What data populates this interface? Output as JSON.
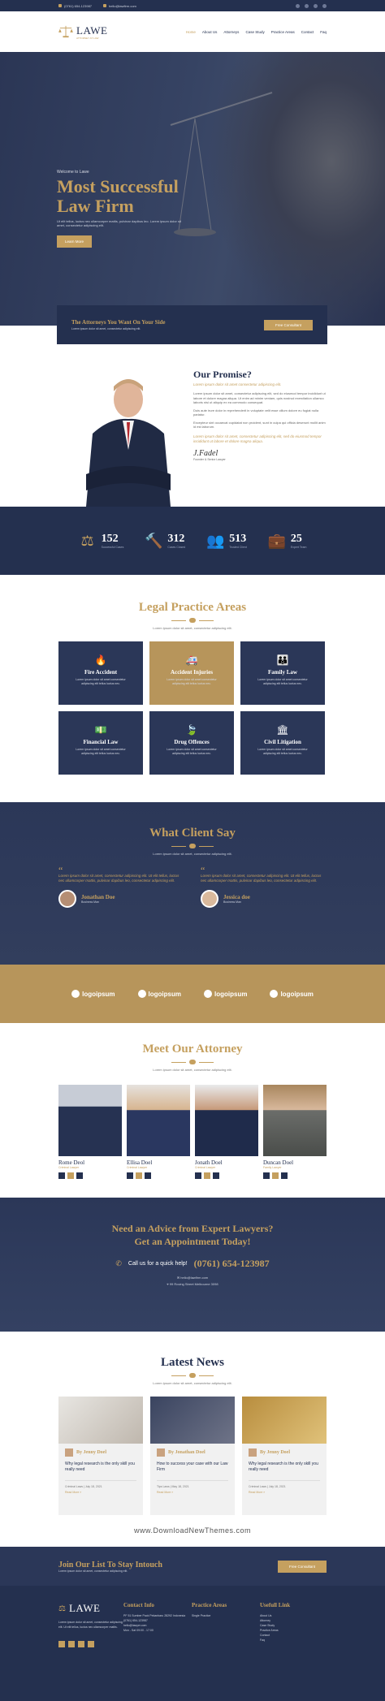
{
  "topbar": {
    "phone": "(0761) 654-123987",
    "email": "hello@lawfirm.com"
  },
  "header": {
    "logo": "LAWE",
    "logo_sub": "ATTORNEY AT LAW",
    "nav": [
      "Home",
      "About Us",
      "Attorneys",
      "Case Study",
      "Practice Areas",
      "Contact",
      "Faq"
    ]
  },
  "hero": {
    "welcome": "Welcome to Lawe",
    "title_line1": "Most Successful",
    "title_line2": "Law Firm",
    "desc": "Ut elit tellus, luctus nec ullamcorper mattis, pulvinar dapibus leo. Lorem ipsum dolor sit amet, consectetur adipiscing elit.",
    "button": "Learn More"
  },
  "cta": {
    "title": "The Attorneys You Want On Your Side",
    "sub": "Lorem ipsum dolor sit amet, consectetur adipiscing elit.",
    "button": "Free Consultant"
  },
  "promise": {
    "title": "Our Promise?",
    "lead": "Lorem ipsum dolor sit amet consectetur adipiscing elit.",
    "p1": "Lorem ipsum dolor sit amet, consectetur adipiscing elit, sed do eiusmod tempor incididunt ut labore et dolore magna aliqua. Ut enim ad minim veniam, quis nostrud exercitation ullamco laboris nisi ut aliquip ex ea commodo consequat.",
    "p2": "Duis aute irure dolor in reprehenderit in voluptate velit esse cillum dolore eu fugiat nulla pariatur.",
    "p3": "Excepteur sint occaecat cupidatat non proident, sunt in culpa qui officia deserunt mollit anim id est laborum.",
    "quote": "Lorem ipsum dolor sit amet, consectetur adipiscing elit, sed do eiusmod tempor incididunt ut labore et dolore magna aliqua.",
    "signature": "J.Fadel",
    "role": "Founder & Senior Lawyer"
  },
  "stats": [
    {
      "icon": "scales-icon",
      "num": "152",
      "label": "Successful Cases"
    },
    {
      "icon": "gavel-icon",
      "num": "312",
      "label": "Cases Closed"
    },
    {
      "icon": "people-icon",
      "num": "513",
      "label": "Trusted Client"
    },
    {
      "icon": "briefcase-icon",
      "num": "25",
      "label": "Expert Team"
    }
  ],
  "practice": {
    "title": "Legal Practice Areas",
    "sub": "Lorem ipsum dolor sit amet, consectetur adipiscing elit.",
    "cards": [
      {
        "t": "Fire Accident",
        "d": "Lorem ipsum dolor sit amet consectetur adipiscing elit tellus luctus nec."
      },
      {
        "t": "Accident Injuries",
        "d": "Lorem ipsum dolor sit amet consectetur adipiscing elit tellus luctus nec."
      },
      {
        "t": "Family Law",
        "d": "Lorem ipsum dolor sit amet consectetur adipiscing elit tellus luctus nec."
      },
      {
        "t": "Financial Law",
        "d": "Lorem ipsum dolor sit amet consectetur adipiscing elit tellus luctus nec."
      },
      {
        "t": "Drug Offences",
        "d": "Lorem ipsum dolor sit amet consectetur adipiscing elit tellus luctus nec."
      },
      {
        "t": "Civil Litigation",
        "d": "Lorem ipsum dolor sit amet consectetur adipiscing elit tellus luctus nec."
      }
    ]
  },
  "testimonials": {
    "title": "What Client Say",
    "sub": "Lorem ipsum dolor sit amet, consectetur adipiscing elit.",
    "items": [
      {
        "text": "Lorem ipsum dolor sit amet, consectetur adipiscing elit. Ut elit tellus, luctus nec ullamcorper mattis, pulvinar dapibus leo, consectetur adipiscing elit.",
        "name": "Jonathan Doe",
        "role": "Business Man"
      },
      {
        "text": "Lorem ipsum dolor sit amet, consectetur adipiscing elit. Ut elit tellus, luctus nec ullamcorper mattis, pulvinar dapibus leo, consectetur adipiscing elit.",
        "name": "Jessica doe",
        "role": "Business Man"
      }
    ]
  },
  "logos": [
    "logoipsum",
    "logoipsum",
    "logoipsum",
    "logoipsum"
  ],
  "attorneys": {
    "title": "Meet Our Attorney",
    "sub": "Lorem ipsum dolor sit amet, consectetur adipiscing elit.",
    "people": [
      {
        "name": "Rome Deol",
        "role": "Criminal Lawyer"
      },
      {
        "name": "Ellisa Doel",
        "role": "Criminal Lawyer"
      },
      {
        "name": "Jonath Doel",
        "role": "Criminal Lawyer"
      },
      {
        "name": "Duncan Doel",
        "role": "Family Lawyer"
      }
    ]
  },
  "appointment": {
    "line1": "Need an Advice from Expert Lawyers?",
    "line2": "Get an Appointment Today!",
    "call_label": "Call us for a quick help!",
    "phone": "(0761) 654-123987",
    "email": "hello@lawfirm.com",
    "address": "99 Roving Street Melbourne 3098"
  },
  "news": {
    "title": "Latest News",
    "sub": "Lorem ipsum dolor sit amet, consectetur adipiscing elit.",
    "items": [
      {
        "by": "By Jenny Doel",
        "title": "Why legal research is the only skill you really need",
        "meta": "Criminal Laws  |  July 18, 2021",
        "more": "Read More »"
      },
      {
        "by": "By Jonathan Doel",
        "title": "How to success your case with our Law Firm",
        "meta": "Tips Laws  |  May 18, 2021",
        "more": "Read More »"
      },
      {
        "by": "By Jenny Doel",
        "title": "Why legal research is the only skill you really need",
        "meta": "Criminal Laws  |  July 18, 2021",
        "more": "Read More »"
      }
    ]
  },
  "watermark": "www.DownloadNewThemes.com",
  "newsletter": {
    "title": "Join Our List To Stay Intouch",
    "sub": "Lorem ipsum dolor sit amet, consectetur adipiscing elit.",
    "button": "Free Consultant"
  },
  "footer": {
    "logo": "LAWE",
    "about": "Lorem ipsum dolor sit amet, consectetur adipiscing elit. Ut elit tellus, luctus nec ullamcorper mattis.",
    "contact_title": "Contact Info",
    "address": "PF 51 Sumber Pack Pekanbaru 28292 Indonesia",
    "phone": "(0761) 654-123987",
    "email": "hello@lawyer.com",
    "hours": "Mon - Sat 09:00 - 17:00",
    "practice_title": "Practice Areas",
    "practice_items": [
      "Single Practice"
    ],
    "links_title": "Usefull Link",
    "links": [
      "About Us",
      "Attorney",
      "Case Study",
      "Practice Areas",
      "Contact",
      "Faq"
    ]
  },
  "colors": {
    "navy": "#24304f",
    "gold": "#c5a05f"
  }
}
